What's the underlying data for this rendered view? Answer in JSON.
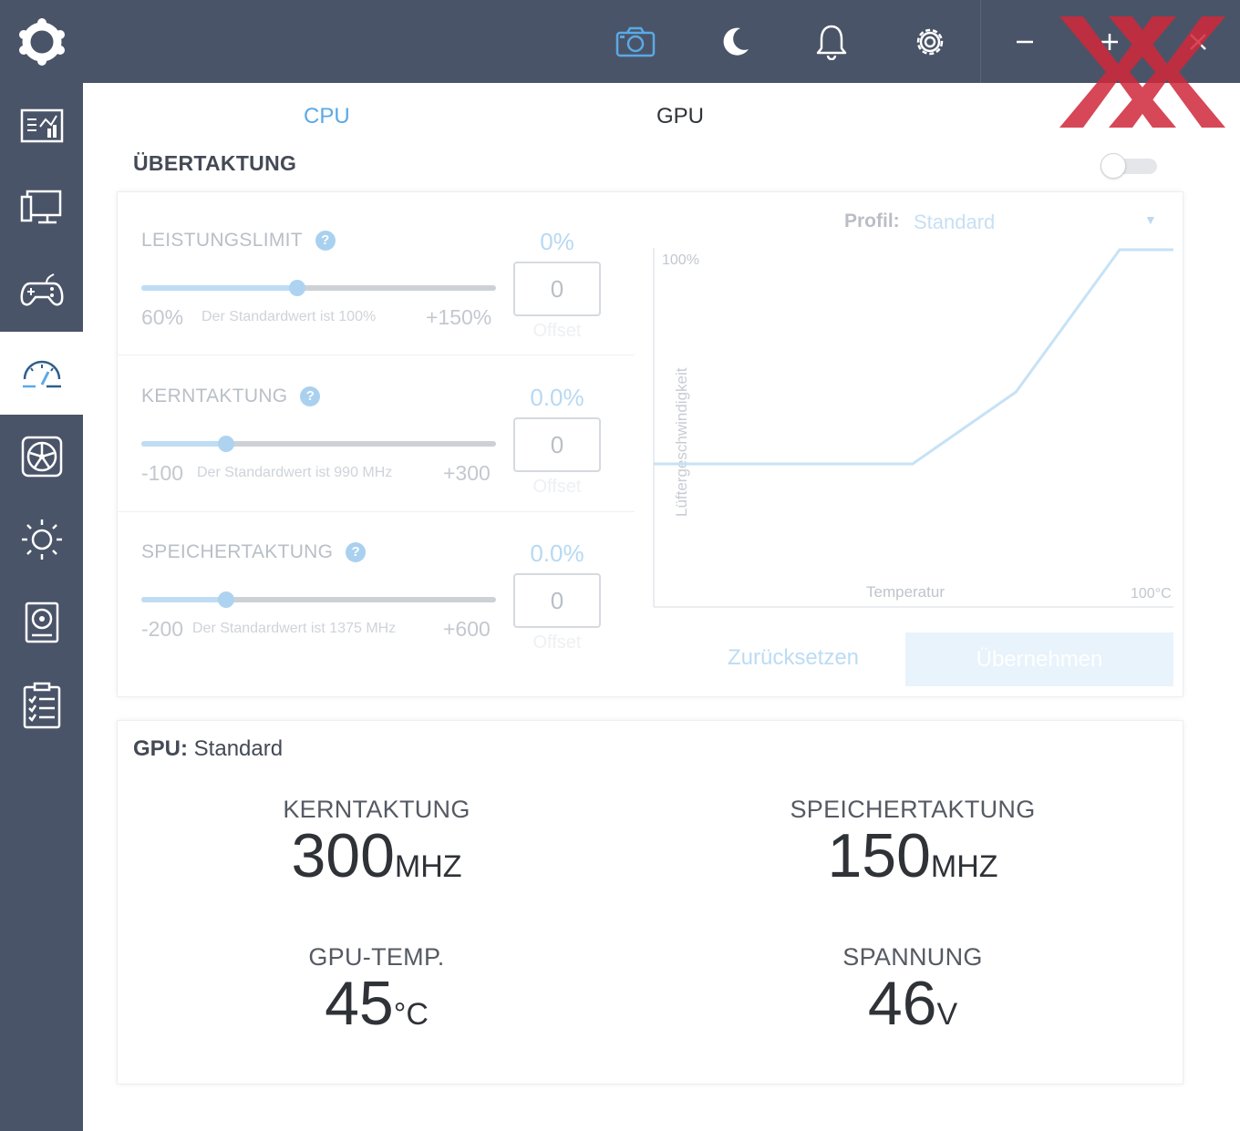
{
  "tabs": {
    "cpu": "CPU",
    "gpu": "GPU"
  },
  "section_title": "ÜBERTAKTUNG",
  "overclock": [
    {
      "label": "LEISTUNGSLIMIT",
      "help": "?",
      "percent": "0%",
      "min": "60%",
      "max": "+150%",
      "default": "Der Standardwert ist 100%",
      "offset_value": "0",
      "offset_label": "Offset",
      "slider_position": 0.44
    },
    {
      "label": "KERNTAKTUNG",
      "help": "?",
      "percent": "0.0%",
      "min": "-100",
      "max": "+300",
      "default": "Der Standardwert ist 990 MHz",
      "offset_value": "0",
      "offset_label": "Offset",
      "slider_position": 0.24
    },
    {
      "label": "SPEICHERTAKTUNG",
      "help": "?",
      "percent": "0.0%",
      "min": "-200",
      "max": "+600",
      "default": "Der Standardwert ist 1375 MHz",
      "offset_value": "0",
      "offset_label": "Offset",
      "slider_position": 0.24
    }
  ],
  "fan_curve": {
    "profil_label": "Profil:",
    "profil_value": "Standard",
    "y_max_label": "100%",
    "y_axis_label": "Lüftergeschwindigkeit",
    "x_axis_label": "Temperatur",
    "x_max_label": "100°C",
    "points": [
      [
        0,
        50
      ],
      [
        50,
        50
      ],
      [
        70,
        67
      ],
      [
        90,
        100
      ],
      [
        100,
        100
      ]
    ]
  },
  "buttons": {
    "reset": "Zurücksetzen",
    "apply": "Übernehmen"
  },
  "gpu_panel": {
    "title_label": "GPU:",
    "title_value": "Standard",
    "stats": {
      "core": {
        "label": "KERNTAKTUNG",
        "value": "300",
        "unit": "MHZ"
      },
      "memory": {
        "label": "SPEICHERTAKTUNG",
        "value": "150",
        "unit": "MHZ"
      },
      "temp": {
        "label": "GPU-TEMP.",
        "value": "45",
        "unit": "°C"
      },
      "voltage": {
        "label": "SPANNUNG",
        "value": "46",
        "unit": "V"
      }
    }
  },
  "colors": {
    "chrome": "#4a5468",
    "accent": "#5aa9e6",
    "watermark": "#d0283a"
  }
}
